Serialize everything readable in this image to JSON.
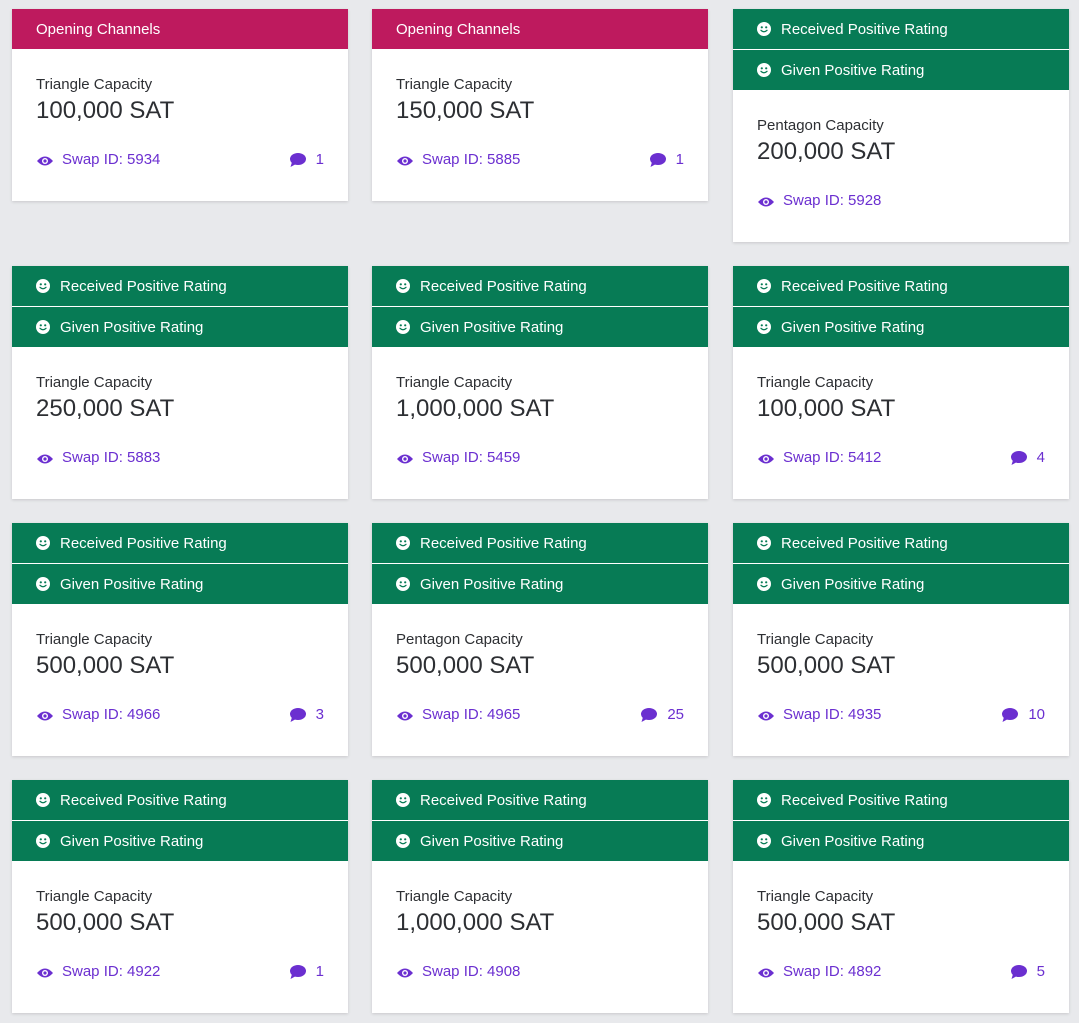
{
  "cards": [
    {
      "badges": [
        {
          "type": "open",
          "label": "Opening Channels"
        }
      ],
      "capacity_label": "Triangle Capacity",
      "capacity_value": "100,000 SAT",
      "swap_label": "Swap ID: 5934",
      "comments": "1"
    },
    {
      "badges": [
        {
          "type": "open",
          "label": "Opening Channels"
        }
      ],
      "capacity_label": "Triangle Capacity",
      "capacity_value": "150,000 SAT",
      "swap_label": "Swap ID: 5885",
      "comments": "1"
    },
    {
      "badges": [
        {
          "type": "rating",
          "label": "Received Positive Rating"
        },
        {
          "type": "rating",
          "label": "Given Positive Rating"
        }
      ],
      "capacity_label": "Pentagon Capacity",
      "capacity_value": "200,000 SAT",
      "swap_label": "Swap ID: 5928",
      "comments": ""
    },
    {
      "badges": [
        {
          "type": "rating",
          "label": "Received Positive Rating"
        },
        {
          "type": "rating",
          "label": "Given Positive Rating"
        }
      ],
      "capacity_label": "Triangle Capacity",
      "capacity_value": "250,000 SAT",
      "swap_label": "Swap ID: 5883",
      "comments": ""
    },
    {
      "badges": [
        {
          "type": "rating",
          "label": "Received Positive Rating"
        },
        {
          "type": "rating",
          "label": "Given Positive Rating"
        }
      ],
      "capacity_label": "Triangle Capacity",
      "capacity_value": "1,000,000 SAT",
      "swap_label": "Swap ID: 5459",
      "comments": ""
    },
    {
      "badges": [
        {
          "type": "rating",
          "label": "Received Positive Rating"
        },
        {
          "type": "rating",
          "label": "Given Positive Rating"
        }
      ],
      "capacity_label": "Triangle Capacity",
      "capacity_value": "100,000 SAT",
      "swap_label": "Swap ID: 5412",
      "comments": "4"
    },
    {
      "badges": [
        {
          "type": "rating",
          "label": "Received Positive Rating"
        },
        {
          "type": "rating",
          "label": "Given Positive Rating"
        }
      ],
      "capacity_label": "Triangle Capacity",
      "capacity_value": "500,000 SAT",
      "swap_label": "Swap ID: 4966",
      "comments": "3"
    },
    {
      "badges": [
        {
          "type": "rating",
          "label": "Received Positive Rating"
        },
        {
          "type": "rating",
          "label": "Given Positive Rating"
        }
      ],
      "capacity_label": "Pentagon Capacity",
      "capacity_value": "500,000 SAT",
      "swap_label": "Swap ID: 4965",
      "comments": "25"
    },
    {
      "badges": [
        {
          "type": "rating",
          "label": "Received Positive Rating"
        },
        {
          "type": "rating",
          "label": "Given Positive Rating"
        }
      ],
      "capacity_label": "Triangle Capacity",
      "capacity_value": "500,000 SAT",
      "swap_label": "Swap ID: 4935",
      "comments": "10"
    },
    {
      "badges": [
        {
          "type": "rating",
          "label": "Received Positive Rating"
        },
        {
          "type": "rating",
          "label": "Given Positive Rating"
        }
      ],
      "capacity_label": "Triangle Capacity",
      "capacity_value": "500,000 SAT",
      "swap_label": "Swap ID: 4922",
      "comments": "1"
    },
    {
      "badges": [
        {
          "type": "rating",
          "label": "Received Positive Rating"
        },
        {
          "type": "rating",
          "label": "Given Positive Rating"
        }
      ],
      "capacity_label": "Triangle Capacity",
      "capacity_value": "1,000,000 SAT",
      "swap_label": "Swap ID: 4908",
      "comments": ""
    },
    {
      "badges": [
        {
          "type": "rating",
          "label": "Received Positive Rating"
        },
        {
          "type": "rating",
          "label": "Given Positive Rating"
        }
      ],
      "capacity_label": "Triangle Capacity",
      "capacity_value": "500,000 SAT",
      "swap_label": "Swap ID: 4892",
      "comments": "5"
    }
  ],
  "icons": {
    "badge": "smile-icon",
    "swap": "eye-icon",
    "comments": "comment-icon"
  },
  "colors": {
    "opening": "#be1a5e",
    "rating": "#077b55",
    "link": "#6b2fd0",
    "background": "#e8e9ec"
  }
}
